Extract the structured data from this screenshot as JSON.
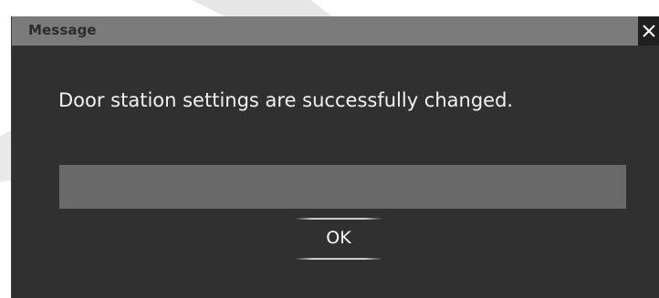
{
  "dialog": {
    "title": "Message",
    "close_icon": "close-icon",
    "message": "Door station settings are successfully changed.",
    "progress": 1.0,
    "ok_label": "OK"
  },
  "colors": {
    "titlebar": "#7b7b7b",
    "body": "#303030",
    "close_button": "#1f1f1f",
    "progress_bar": "#6a6a6a",
    "text": "#f2f2f2"
  }
}
